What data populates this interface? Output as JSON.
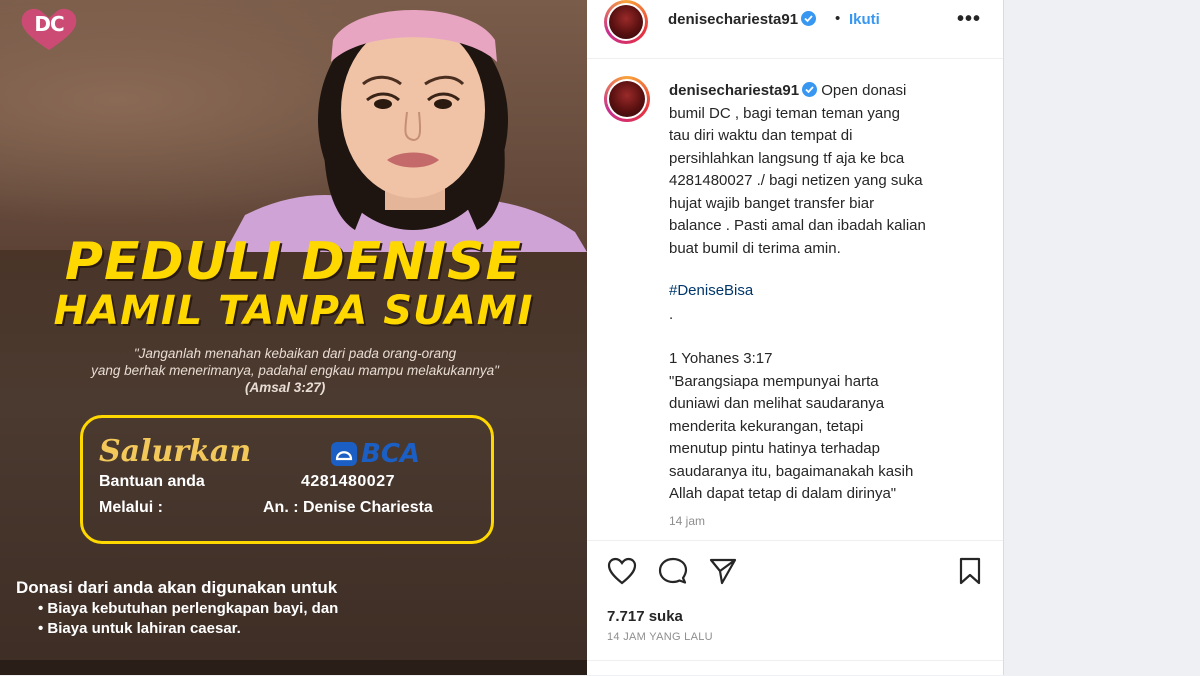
{
  "poster": {
    "logo_text": "DC",
    "headline_1": "PEDULI DENISE",
    "headline_2": "HAMIL TANPA SUAMI",
    "quote_1": "\"Janganlah menahan kebaikan dari pada orang-orang",
    "quote_2": "yang berhak menerimanya, padahal engkau mampu melakukannya\"",
    "quote_ref": "(Amsal 3:27)",
    "salurkan": "Salurkan",
    "bantuan_label": "Bantuan anda",
    "melalui_label": "Melalui :",
    "bank_name": "BCA",
    "account_number": "4281480027",
    "account_name": "An. : Denise Chariesta",
    "donasi_title": "Donasi dari anda akan digunakan untuk",
    "bullet_1": "• Biaya kebutuhan perlengkapan bayi, dan",
    "bullet_2": "• Biaya untuk lahiran caesar."
  },
  "header": {
    "username": "denisechariesta91",
    "dot": "•",
    "follow_label": "Ikuti",
    "more_label": "•••"
  },
  "caption": {
    "username": "denisechariesta91",
    "lines": [
      "Open donasi",
      "bumil DC , bagi teman teman yang",
      "tau diri waktu dan tempat di",
      "persihlahkan langsung tf aja ke bca",
      "4281480027 ./ bagi netizen yang suka",
      "hujat wajib banget transfer biar",
      "balance . Pasti amal dan ibadah kalian",
      "buat bumil di terima amin."
    ],
    "hashtag": "#DeniseBisa",
    "period": ".",
    "verse_lines": [
      "1 Yohanes 3:17",
      "\"Barangsiapa mempunyai harta",
      "duniawi dan melihat saudaranya",
      "menderita kekurangan, tetapi",
      "menutup pintu hatinya terhadap",
      "saudaranya itu, bagaimanakah kasih",
      "Allah dapat tetap di dalam dirinya\""
    ],
    "time": "14 jam"
  },
  "footer": {
    "likes": "7.717 suka",
    "ago": "14 JAM YANG LALU"
  },
  "colors": {
    "headline": "#ffd800",
    "link_blue": "#3897f0",
    "bca_blue": "#1b5fc4"
  }
}
